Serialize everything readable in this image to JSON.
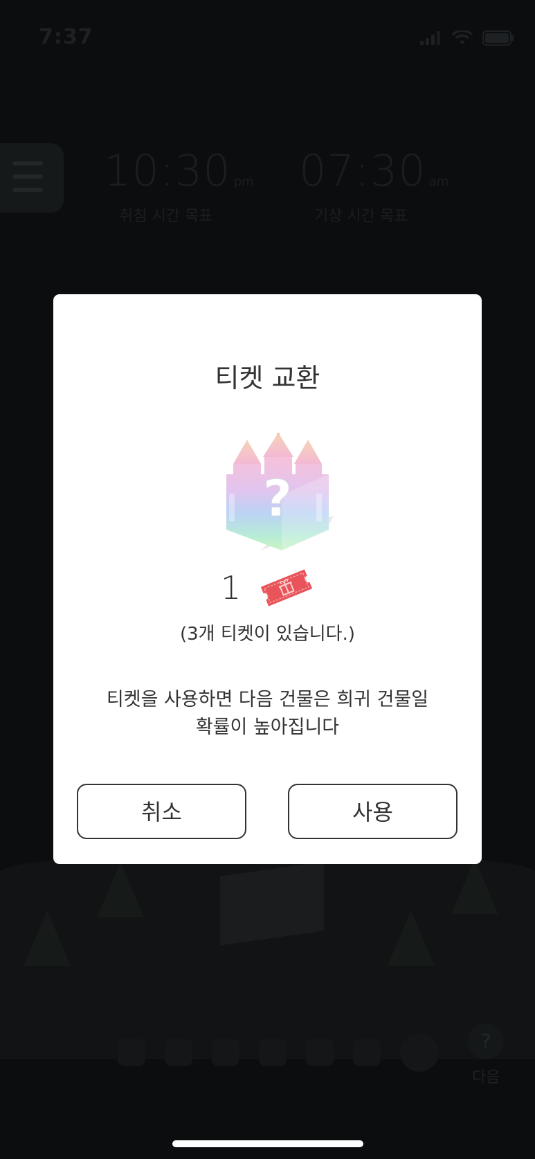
{
  "status_bar": {
    "time": "7:37"
  },
  "background": {
    "bedtime_goal": {
      "value": "10:30",
      "ampm": "pm",
      "label": "취침 시간 목표"
    },
    "wake_goal": {
      "value": "07:30",
      "ampm": "am",
      "label": "기상 시간 목표"
    },
    "next_label": "다음",
    "next_symbol": "?"
  },
  "dialog": {
    "title": "티켓 교환",
    "mystery_symbol": "?",
    "ticket_cost": "1",
    "tickets_available": "(3개 티켓이 있습니다.)",
    "message_line1": "티켓을 사용하면 다음 건물은 희귀 건물일",
    "message_line2": "확률이 높아집니다",
    "cancel_label": "취소",
    "use_label": "사용"
  },
  "colors": {
    "overlay_bg": "#0c0d0e",
    "dialog_bg": "#ffffff",
    "text": "#333333",
    "ticket": "#e9545a"
  }
}
